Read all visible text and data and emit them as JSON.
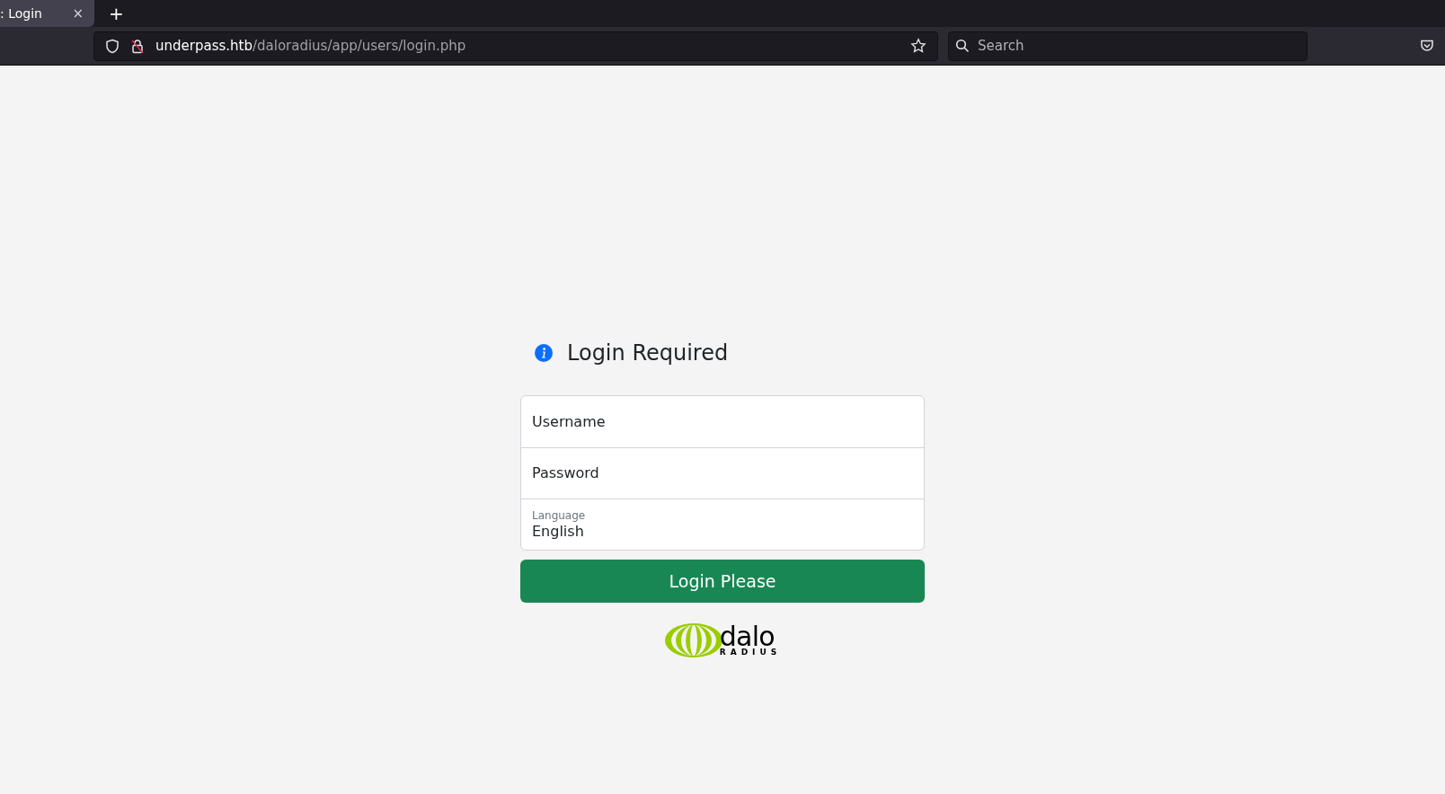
{
  "browser": {
    "tabs": [
      {
        "title": ": Login",
        "close": "×",
        "selected": true
      }
    ],
    "new_tab": "+",
    "url": {
      "host": "underpass.htb",
      "path": "/daloradius/app/users/login.php"
    },
    "search": {
      "placeholder": "Search"
    }
  },
  "login": {
    "title": "Login Required",
    "fields": [
      {
        "kind": "text",
        "placeholder": "Username"
      },
      {
        "kind": "password",
        "placeholder": "Password"
      },
      {
        "kind": "select",
        "label": "Language",
        "value": "English"
      }
    ],
    "button": "Login Please",
    "logo": {
      "word": "dalo",
      "sub": "RADIUS"
    }
  }
}
